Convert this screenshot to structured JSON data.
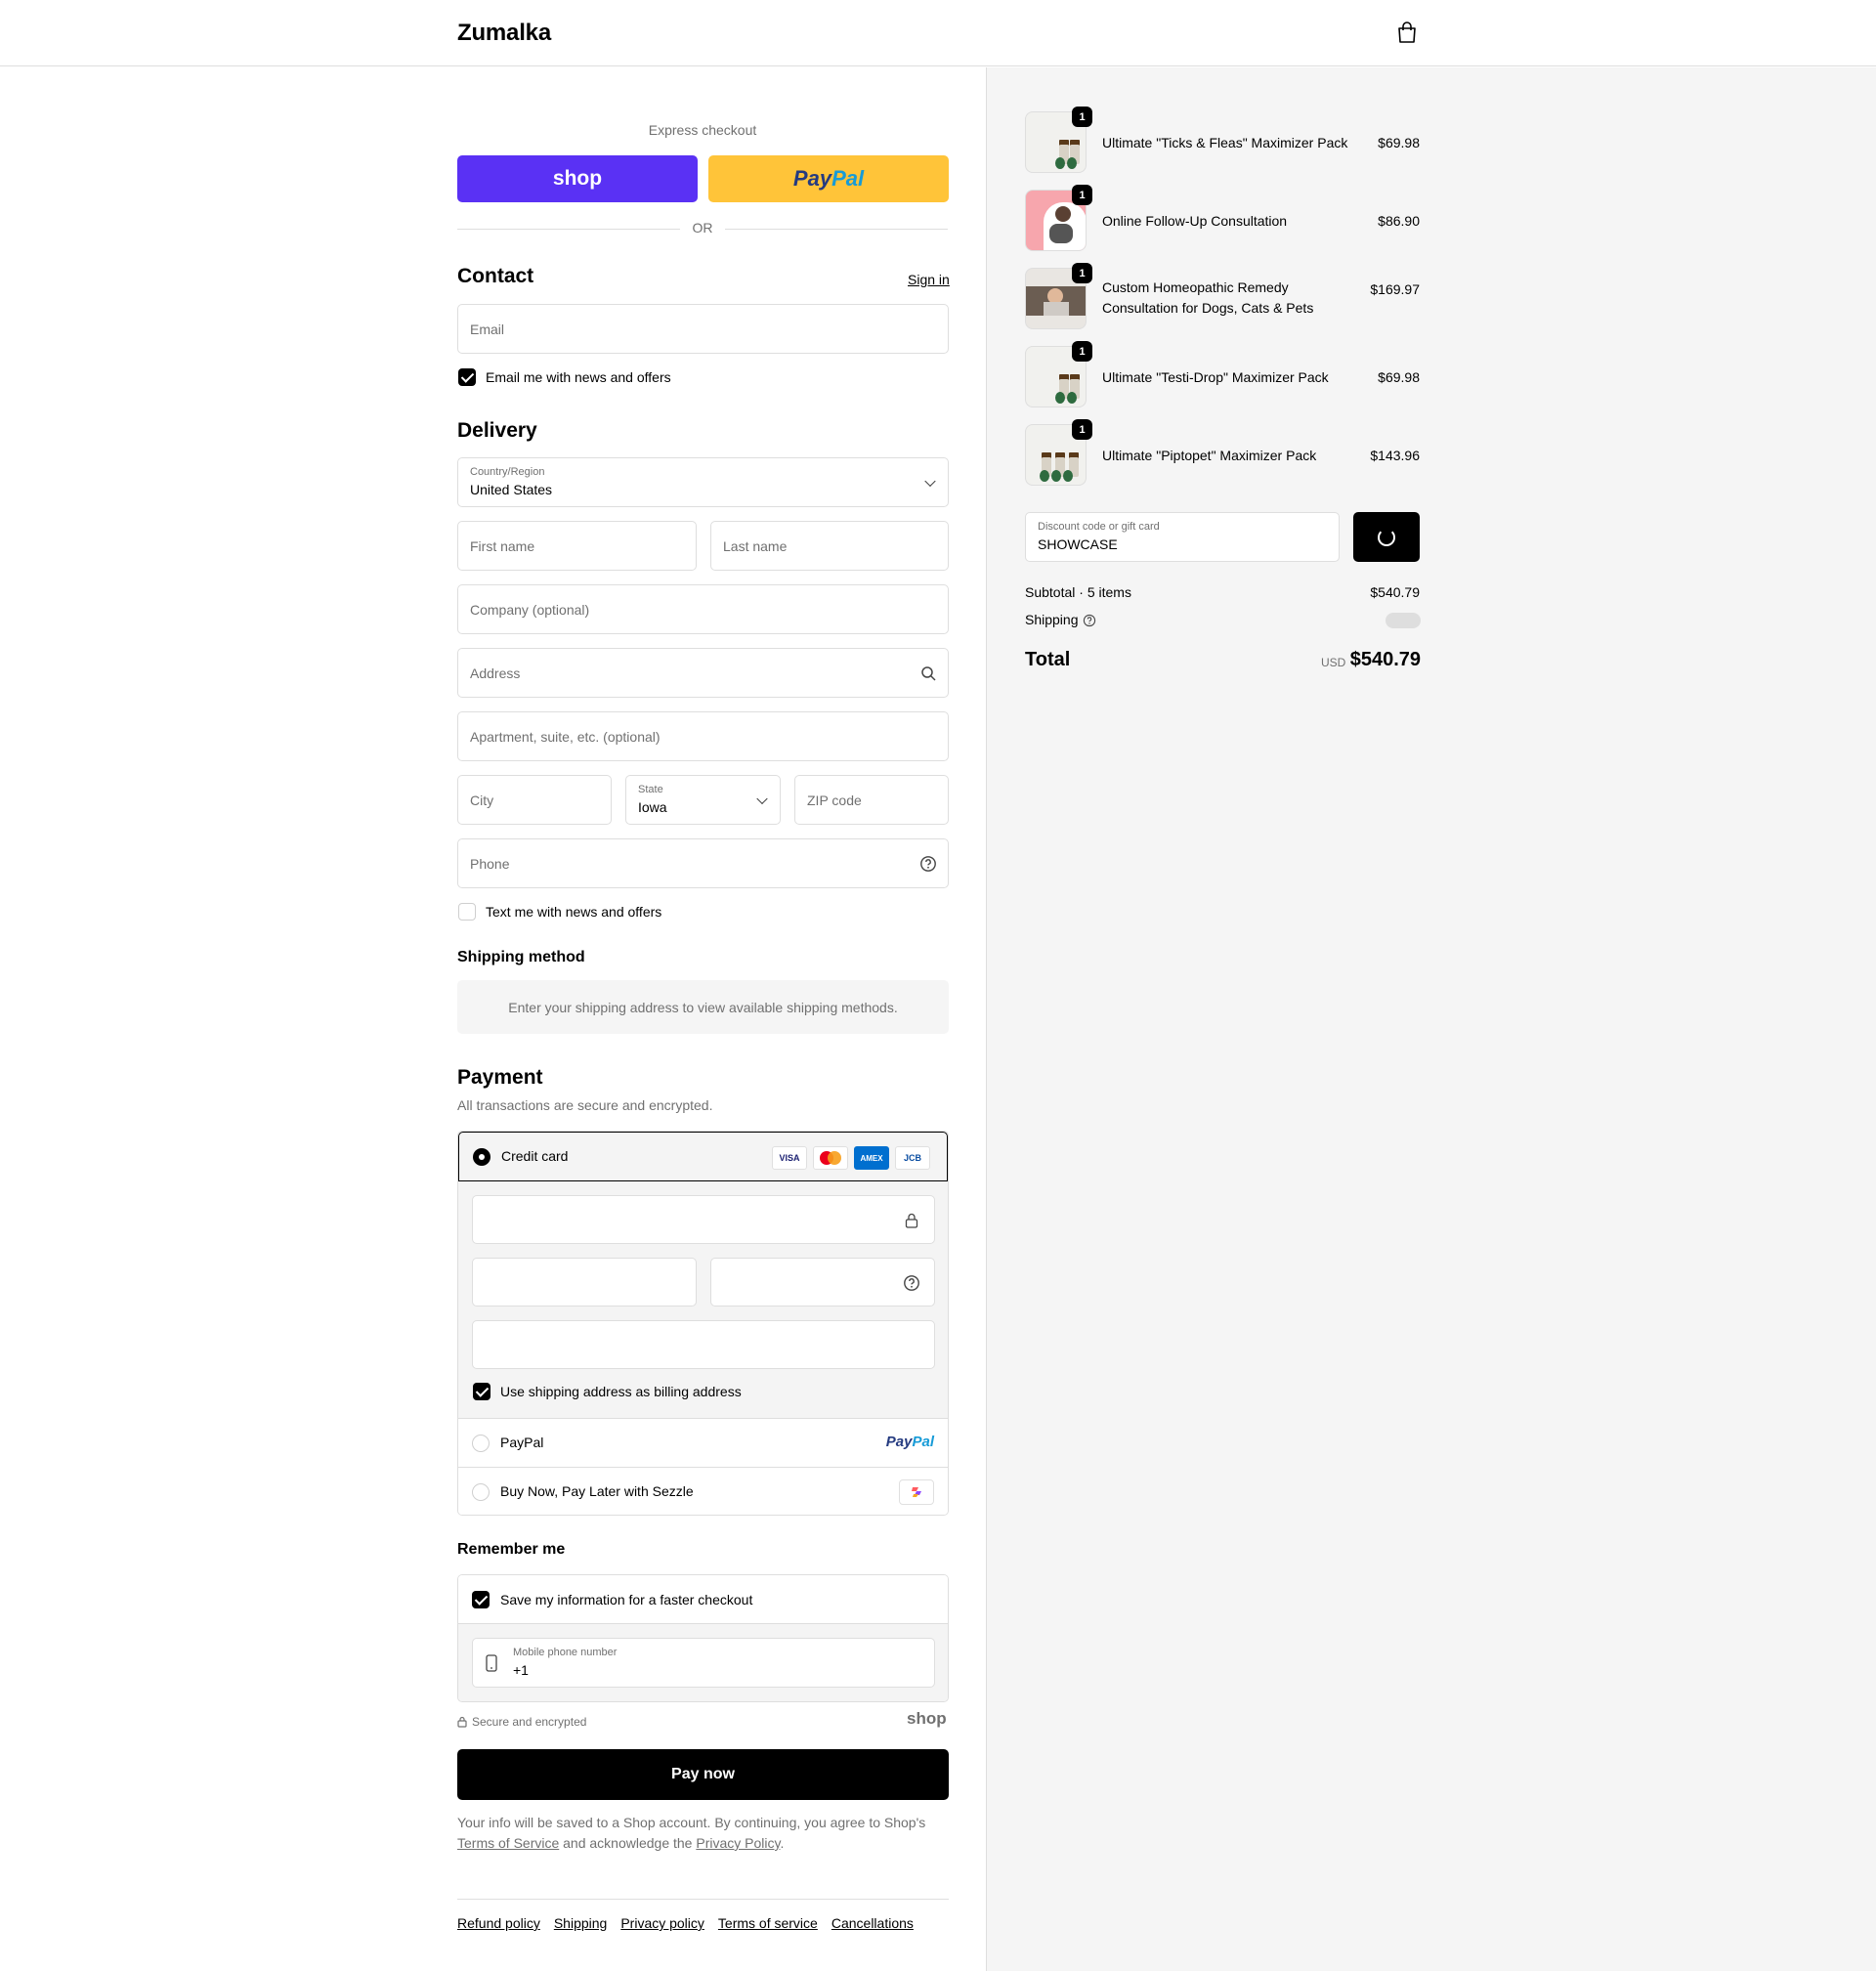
{
  "header": {
    "brand": "Zumalka",
    "cart_icon": "shopping-bag-icon"
  },
  "express": {
    "label": "Express checkout",
    "shop_label": "shop",
    "paypal_label_a": "Pay",
    "paypal_label_b": "Pal",
    "or": "OR"
  },
  "contact": {
    "title": "Contact",
    "sign_in": "Sign in",
    "email_placeholder": "Email",
    "newsletter_label": "Email me with news and offers",
    "newsletter_checked": true
  },
  "delivery": {
    "title": "Delivery",
    "country_label": "Country/Region",
    "country_value": "United States",
    "first_name_placeholder": "First name",
    "last_name_placeholder": "Last name",
    "company_placeholder": "Company (optional)",
    "address_placeholder": "Address",
    "apartment_placeholder": "Apartment, suite, etc. (optional)",
    "city_placeholder": "City",
    "state_label": "State",
    "state_value": "Iowa",
    "zip_placeholder": "ZIP code",
    "phone_placeholder": "Phone",
    "sms_label": "Text me with news and offers",
    "sms_checked": false
  },
  "shipping_method": {
    "title": "Shipping method",
    "empty_text": "Enter your shipping address to view available shipping methods."
  },
  "payment": {
    "title": "Payment",
    "subtitle": "All transactions are secure and encrypted.",
    "credit_card_label": "Credit card",
    "card_logos": [
      "VISA",
      "mastercard",
      "AMEX",
      "JCB"
    ],
    "billing_same_label": "Use shipping address as billing address",
    "billing_same_checked": true,
    "paypal_option_label": "PayPal",
    "paypal_logo_a": "Pay",
    "paypal_logo_b": "Pal",
    "sezzle_option_label": "Buy Now, Pay Later with Sezzle",
    "selected": "Credit card"
  },
  "remember": {
    "title": "Remember me",
    "save_label": "Save my information for a faster checkout",
    "save_checked": true,
    "mobile_label": "Mobile phone number",
    "mobile_value": "+1"
  },
  "secure": {
    "text": "Secure and encrypted",
    "shop_logo": "shop"
  },
  "pay_now": "Pay now",
  "legal": {
    "text_1": "Your info will be saved to a Shop account. By continuing, you agree to Shop's",
    "terms_link": "Terms of Service",
    "text_2": "and acknowledge the",
    "privacy_link": "Privacy Policy",
    "text_3": "."
  },
  "footer_links": [
    "Refund policy",
    "Shipping",
    "Privacy policy",
    "Terms of service",
    "Cancellations"
  ],
  "order": {
    "items": [
      {
        "name": "Ultimate \"Ticks & Fleas\" Maximizer Pack",
        "price": "$69.98",
        "qty": "1"
      },
      {
        "name": "Online Follow-Up Consultation",
        "price": "$86.90",
        "qty": "1"
      },
      {
        "name": "Custom Homeopathic Remedy Consultation for Dogs, Cats & Pets",
        "price": "$169.97",
        "qty": "1"
      },
      {
        "name": "Ultimate \"Testi-Drop\" Maximizer Pack",
        "price": "$69.98",
        "qty": "1"
      },
      {
        "name": "Ultimate \"Piptopet\" Maximizer Pack",
        "price": "$143.96",
        "qty": "1"
      }
    ],
    "discount_label": "Discount code or gift card",
    "discount_value": "SHOWCASE",
    "subtotal_label": "Subtotal · 5 items",
    "subtotal_value": "$540.79",
    "shipping_label": "Shipping",
    "total_label": "Total",
    "currency": "USD",
    "total_value": "$540.79"
  },
  "colors": {
    "shop_purple": "#5a31f4",
    "paypal_yellow": "#ffc439",
    "paypal_dark": "#253b80",
    "paypal_light": "#179bd7"
  }
}
